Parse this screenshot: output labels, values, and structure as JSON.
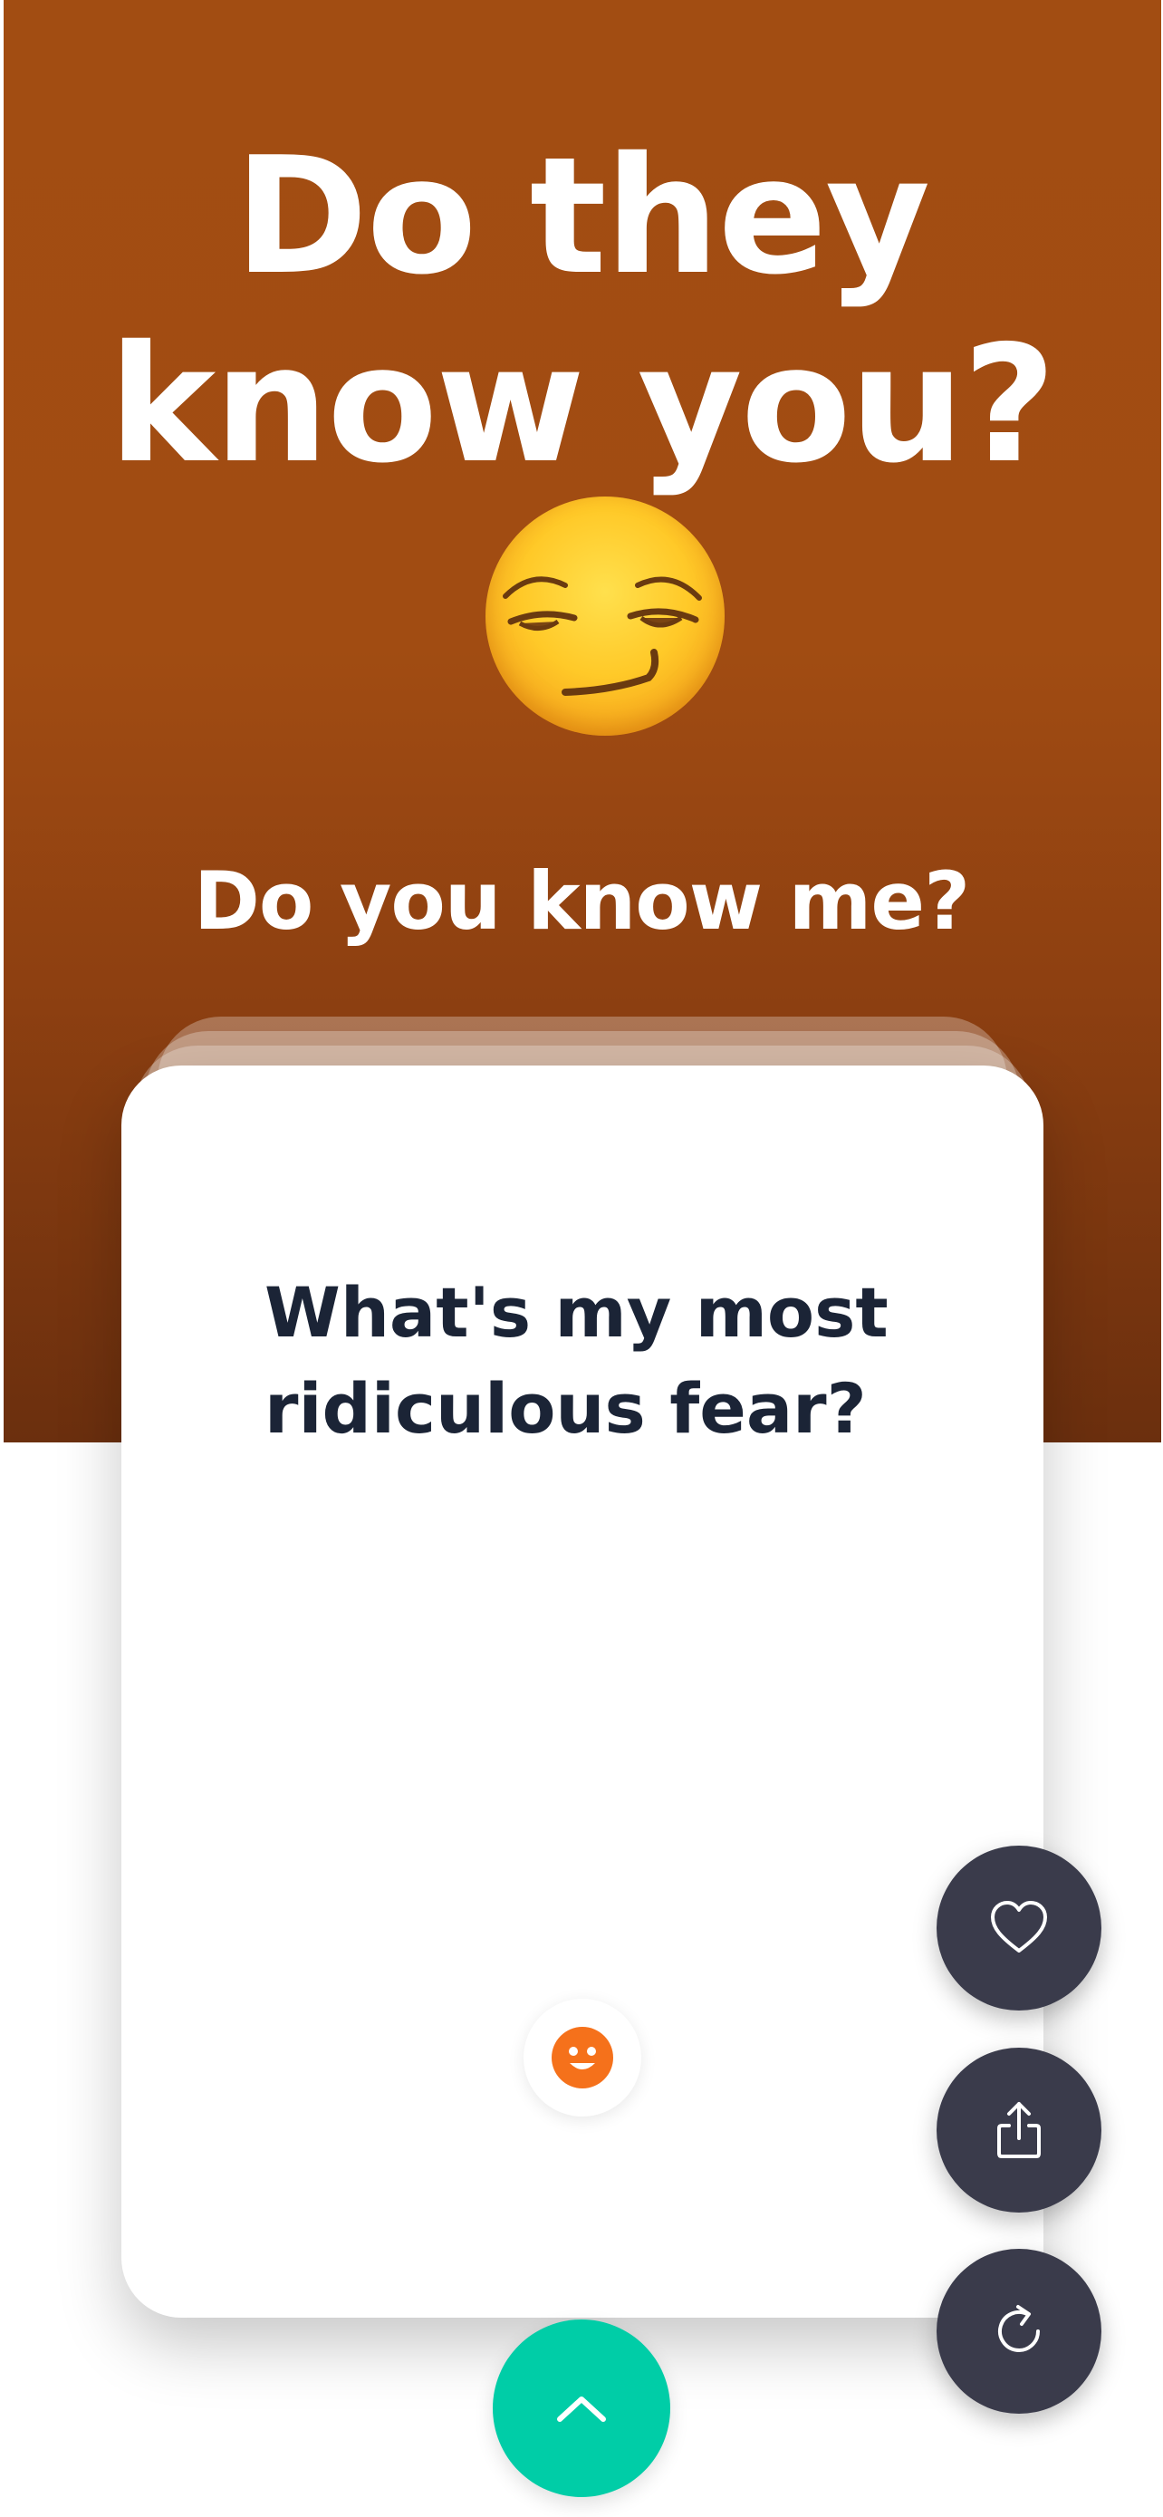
{
  "header": {
    "title_line1": "Do they",
    "title_line2": "know you?",
    "emoji": "smirking-face-icon",
    "subtitle": "Do you know me?"
  },
  "card": {
    "question_line1": "What's my most",
    "question_line2": "ridiculous fear?",
    "badge_icon": "smiley-icon"
  },
  "actions": {
    "like_icon": "heart-icon",
    "share_icon": "share-icon",
    "refresh_icon": "refresh-icon",
    "expand_icon": "chevron-up-icon"
  },
  "colors": {
    "hero": "#a24d12",
    "card_text": "#1b2436",
    "fab": "#3a3b4b",
    "accent_teal": "#00cda7",
    "badge_orange": "#f5711b"
  }
}
